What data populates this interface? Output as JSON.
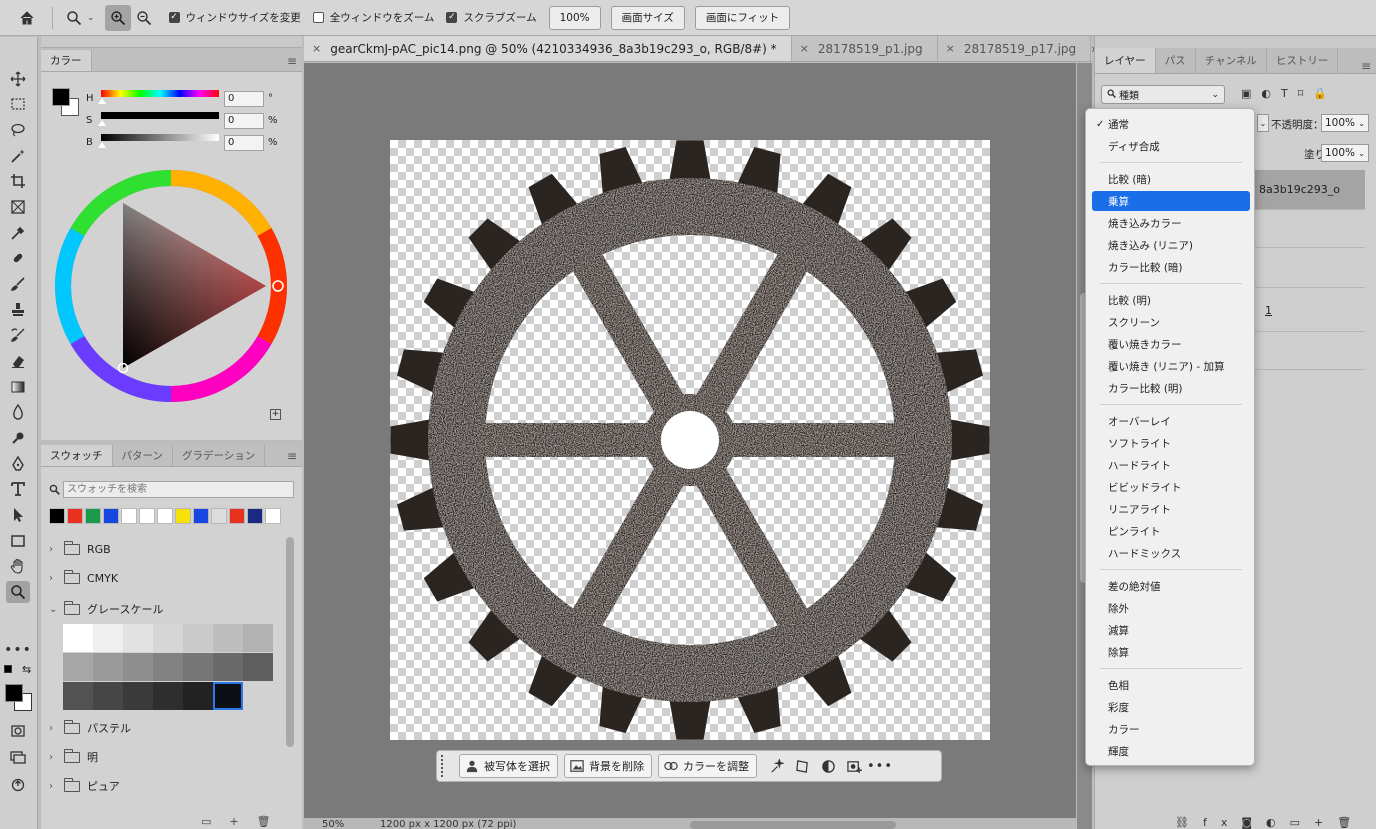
{
  "options_bar": {
    "resize_windows_label": "ウィンドウサイズを変更",
    "zoom_all_label": "全ウィンドウをズーム",
    "scrubby_zoom_label": "スクラブズーム",
    "zoom_100_label": "100%",
    "fill_screen_label": "画面サイズ",
    "fit_screen_label": "画面にフィット"
  },
  "color_panel": {
    "tab": "カラー",
    "h_label": "H",
    "s_label": "S",
    "b_label": "B",
    "h_value": "0",
    "s_value": "0",
    "b_value": "0",
    "h_unit": "°",
    "s_unit": "%",
    "b_unit": "%",
    "foreground": "#000000",
    "background": "#ffffff"
  },
  "swatch_panel": {
    "tabs": [
      "スウォッチ",
      "パターン",
      "グラデーション"
    ],
    "search_placeholder": "スウォッチを検索",
    "recent_colors": [
      "#000000",
      "#e8321e",
      "#1c9a4b",
      "#1646e0",
      "#ffffff",
      "#ffffff",
      "#ffffff",
      "#f5e20a",
      "#1646e0",
      "#dddddd",
      "#e8321e",
      "#1a2a80",
      "#ffffff"
    ],
    "folders_top": [
      "RGB",
      "CMYK",
      "グレースケール"
    ],
    "grays": [
      "#ffffff",
      "#efefef",
      "#e2e2e2",
      "#d6d6d6",
      "#cacaca",
      "#bebebe",
      "#b2b2b2",
      "#a6a6a6",
      "#9a9a9a",
      "#8e8e8e",
      "#828282",
      "#767676",
      "#6a6a6a",
      "#5e5e5e",
      "#525252",
      "#464646",
      "#3a3a3a",
      "#2e2e2e",
      "#222222",
      "#0d0f17"
    ],
    "folders_bottom": [
      "パステル",
      "明",
      "ピュア"
    ]
  },
  "document_tabs": [
    {
      "label": "gearCkmJ-pAC_pic14.png @ 50% (4210334936_8a3b19c293_o, RGB/8#) *",
      "active": true
    },
    {
      "label": "28178519_p1.jpg",
      "active": false
    },
    {
      "label": "28178519_p17.jpg",
      "active": false
    }
  ],
  "context_bar": {
    "select_subject": "被写体を選択",
    "remove_bg": "背景を削除",
    "adjust_color": "カラーを調整"
  },
  "status_bar": {
    "zoom": "50%",
    "size": "1200 px x 1200 px (72 ppi)"
  },
  "layers_panel": {
    "tabs": [
      "レイヤー",
      "パス",
      "チャンネル",
      "ヒストリー"
    ],
    "filter_kind": "種類",
    "opacity_label": "不透明度：",
    "opacity_value": "100%",
    "fill_label": "塗り：",
    "fill_value": "100%",
    "layer_name_partial": "8a3b19c293_o",
    "layer_2_partial": "1"
  },
  "blend_modes": {
    "groups": [
      [
        "通常",
        "ディザ合成"
      ],
      [
        "比較 (暗)",
        "乗算",
        "焼き込みカラー",
        "焼き込み (リニア)",
        "カラー比較 (暗)"
      ],
      [
        "比較 (明)",
        "スクリーン",
        "覆い焼きカラー",
        "覆い焼き (リニア) - 加算",
        "カラー比較 (明)"
      ],
      [
        "オーバーレイ",
        "ソフトライト",
        "ハードライト",
        "ビビッドライト",
        "リニアライト",
        "ピンライト",
        "ハードミックス"
      ],
      [
        "差の絶対値",
        "除外",
        "減算",
        "除算"
      ],
      [
        "色相",
        "彩度",
        "カラー",
        "輝度"
      ]
    ],
    "checked": "通常",
    "highlighted": "乗算"
  },
  "icons": {
    "home": "home-icon",
    "zoom": "zoom-icon",
    "zoom_in": "zoom-in-icon",
    "zoom_out": "zoom-out-icon"
  }
}
